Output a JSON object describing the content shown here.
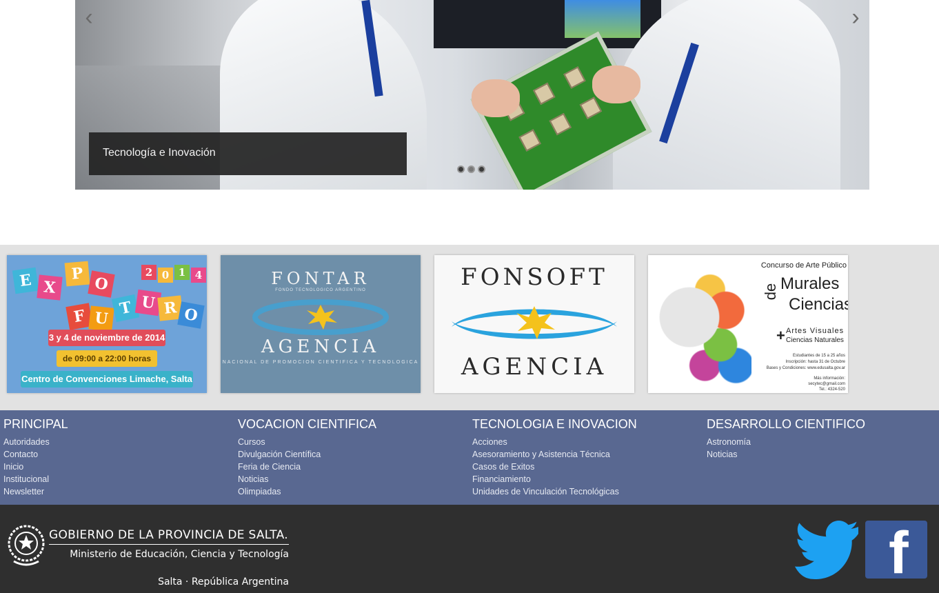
{
  "slider": {
    "caption": "Tecnología e Inovación",
    "prev_icon": "‹",
    "next_icon": "›",
    "dot_count": 3,
    "active_dot": 1
  },
  "banners": {
    "expo": {
      "letters": [
        "E",
        "X",
        "P",
        "O",
        "F",
        "U",
        "T",
        "U",
        "R",
        "O"
      ],
      "year": [
        "2",
        "0",
        "1",
        "4"
      ],
      "date": "3 y 4 de noviembre de 2014",
      "hours": "de 09:00 a 22:00 horas",
      "venue": "Centro de Convenciones Limache, Salta"
    },
    "fontar": {
      "title": "FONTAR",
      "subtitle": "FONDO TECNOLOGICO ARGENTINO",
      "agency": "AGENCIA",
      "agency_sub": "NACIONAL DE PROMOCION CIENTIFICA Y TECNOLOGICA"
    },
    "fonsoft": {
      "title": "FONSOFT",
      "agency": "AGENCIA"
    },
    "murales": {
      "line1": "Concurso de Arte Público",
      "de": "de",
      "murales": "Murales",
      "ciencias": "Ciencias",
      "plus": "+",
      "artes": "Artes Visuales",
      "naturales": "Ciencias Naturales",
      "small1": "Estudiantes de 15 a 25 años",
      "small2": "Inscripción: hasta 31 de Octubre",
      "small3": "Bases y Condiciones: www.edusalta.gov.ar",
      "small4": "Más información:",
      "small5": "secytec@gmail.com",
      "small6": "Tel.: 4324-520"
    }
  },
  "footer": {
    "columns": [
      {
        "title": "PRINCIPAL",
        "links": [
          "Autoridades",
          "Contacto",
          "Inicio",
          "Institucional",
          "Newsletter"
        ]
      },
      {
        "title": "VOCACION CIENTIFICA",
        "links": [
          "Cursos",
          "Divulgación Científica",
          "Feria de Ciencia",
          "Noticias",
          "Olimpiadas"
        ]
      },
      {
        "title": "TECNOLOGIA E INOVACION",
        "links": [
          "Acciones",
          "Asesoramiento y Asistencia Técnica",
          "Casos de Exitos",
          "Financiamiento",
          "Unidades de Vinculación Tecnológicas"
        ]
      },
      {
        "title": "DESARROLLO CIENTIFICO",
        "links": [
          "Astronomía",
          "Noticias"
        ]
      }
    ]
  },
  "bottom": {
    "gov_title": "GOBIERNO DE LA PROVINCIA DE SALTA.",
    "ministry": "Ministerio de Educación, Ciencia y Tecnología",
    "location": "Salta · República Argentina",
    "facebook_glyph": "f"
  },
  "colors": {
    "footer_bg": "#596891",
    "bottom_bg": "#2f2f2f",
    "banner_strip_bg": "#e2e2e2",
    "twitter_blue": "#1da1f2",
    "facebook_blue": "#3b5998"
  }
}
